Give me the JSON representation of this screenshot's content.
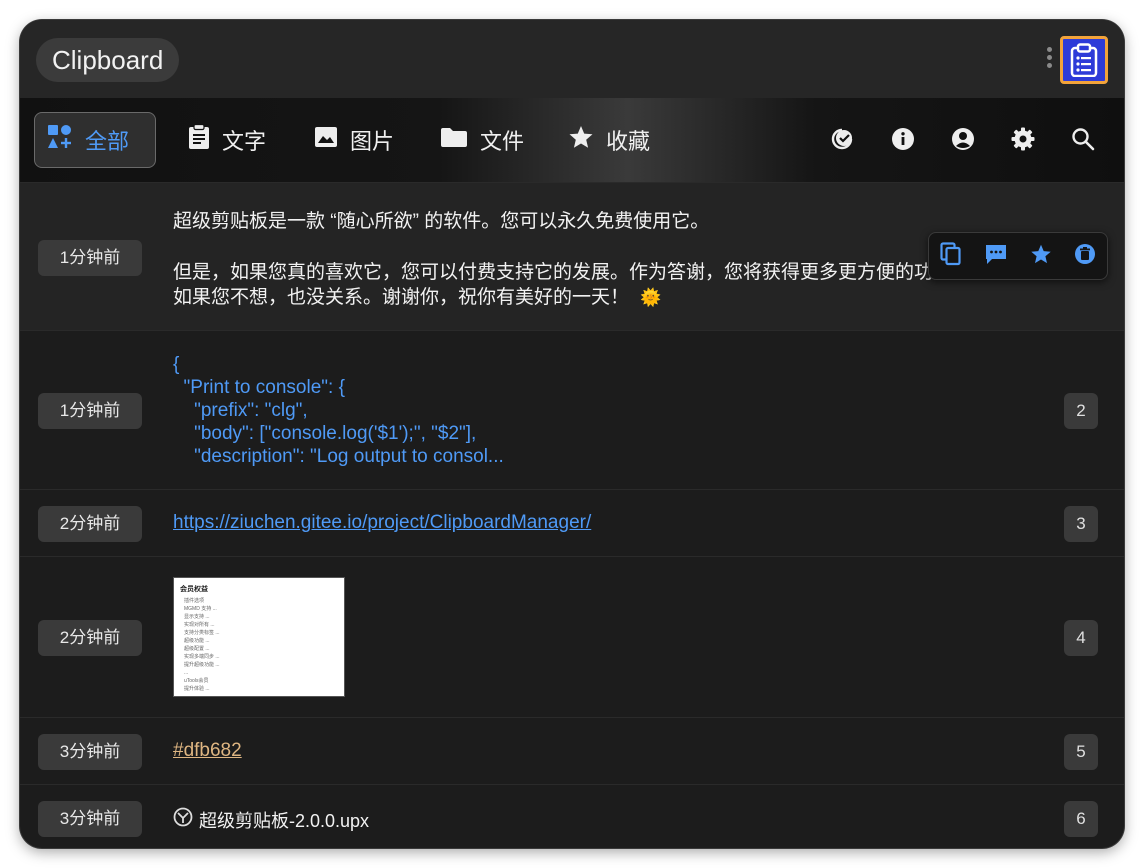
{
  "window": {
    "title": "Clipboard"
  },
  "tabs": [
    {
      "label": "全部",
      "icon": "category-icon",
      "active": true
    },
    {
      "label": "文字",
      "icon": "clipboard-text-icon",
      "active": false
    },
    {
      "label": "图片",
      "icon": "image-icon",
      "active": false
    },
    {
      "label": "文件",
      "icon": "folder-icon",
      "active": false
    },
    {
      "label": "收藏",
      "icon": "star-icon",
      "active": false
    }
  ],
  "toolbar_actions": [
    "check-badge-icon",
    "info-icon",
    "account-icon",
    "settings-icon",
    "search-icon"
  ],
  "colors": {
    "accent": "#4f9af6",
    "hex_item": "#dfb682",
    "window_bg": "#1c1c1c"
  },
  "items": [
    {
      "time": "1分钟前",
      "type": "text",
      "line1": "超级剪贴板是一款 “随心所欲” 的软件。您可以永久免费使用它。",
      "line2": "但是，如果您真的喜欢它，您可以付费支持它的发展。作为答谢，您将获得更多更方便的功能。",
      "line3": "如果您不想，也没关系。谢谢你，祝你有美好的一天！",
      "emoji": "🌞"
    },
    {
      "time": "1分钟前",
      "type": "code",
      "index": "2",
      "code": "{\n  \"Print to console\": {\n    \"prefix\": \"clg\",\n    \"body\": [\"console.log('$1');\", \"$2\"],\n    \"description\": \"Log output to consol..."
    },
    {
      "time": "2分钟前",
      "type": "link",
      "index": "3",
      "text": "https://ziuchen.gitee.io/project/ClipboardManager/"
    },
    {
      "time": "2分钟前",
      "type": "image",
      "index": "4",
      "thumb_title": "会员权益",
      "thumb_lines": [
        "插件选项",
        "MGMD 支持 ...",
        "显示支持 ...",
        "实现对所有 ...",
        "支持分类标签 ...",
        "超级功能 ...",
        "超级配置 ...",
        "实现多端同步 ...",
        "提升超级功能 ...",
        "...",
        "uTools会员",
        "提升体验 ..."
      ]
    },
    {
      "time": "3分钟前",
      "type": "color",
      "index": "5",
      "text": "#dfb682"
    },
    {
      "time": "3分钟前",
      "type": "file",
      "index": "6",
      "text": "超级剪贴板-2.0.0.upx"
    }
  ],
  "hover_actions": [
    "copy-icon",
    "comment-icon",
    "favorite-star-icon",
    "delete-icon"
  ]
}
